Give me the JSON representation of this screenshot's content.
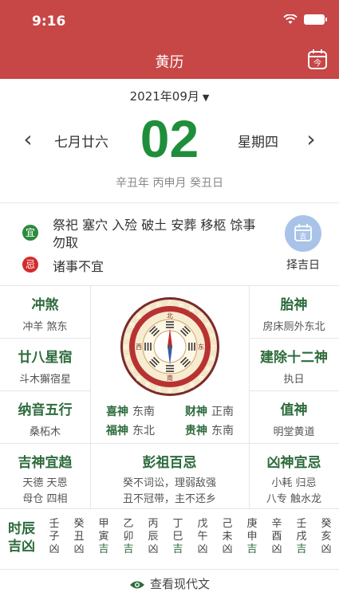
{
  "status": {
    "time": "9:16"
  },
  "nav": {
    "title": "黄历",
    "today_icon_text": "今"
  },
  "month": {
    "label": "2021年09月"
  },
  "day": {
    "lunar": "七月廿六",
    "number": "02",
    "weekday": "星期四",
    "ganzhi": "辛丑年 丙申月 癸丑日"
  },
  "yiji": {
    "yi_badge": "宜",
    "yi_text": "祭祀 塞穴 入殓 破土 安葬 移柩 馀事勿取",
    "ji_badge": "忌",
    "ji_text": "诸事不宜",
    "zeji_label": "择吉日",
    "zeji_icon": "吉"
  },
  "cells": {
    "chongsha": {
      "title": "冲煞",
      "sub": "冲羊 煞东"
    },
    "taishen": {
      "title": "胎神",
      "sub": "房床厕外东北"
    },
    "xiu": {
      "title": "廿八星宿",
      "sub": "斗木獬宿星"
    },
    "jianchu": {
      "title": "建除十二神",
      "sub": "执日"
    },
    "nayin": {
      "title": "纳音五行",
      "sub": "桑柘木"
    },
    "zhishen": {
      "title": "值神",
      "sub": "明堂黄道"
    },
    "jishen": {
      "title": "吉神宜趋",
      "sub1": "天德 天恩",
      "sub2": "母仓 四相"
    },
    "pengzu": {
      "title": "彭祖百忌",
      "sub1": "癸不词讼，理弱敌强",
      "sub2": "丑不冠带，主不还乡"
    },
    "xiongshen": {
      "title": "凶神宜忌",
      "sub1": "小耗 归忌",
      "sub2": "八专 触水龙"
    }
  },
  "gods": [
    {
      "k": "喜神",
      "v": "东南"
    },
    {
      "k": "财神",
      "v": "正南"
    },
    {
      "k": "福神",
      "v": "东北"
    },
    {
      "k": "贵神",
      "v": "东南"
    }
  ],
  "compass": {
    "outer": [
      "乙",
      "辰",
      "巽",
      "巳",
      "丙",
      "午",
      "丁",
      "未",
      "坤",
      "申",
      "庚",
      "酉",
      "辛",
      "戌",
      "乾",
      "亥",
      "壬",
      "子",
      "癸",
      "丑",
      "艮",
      "寅",
      "甲",
      "卯"
    ],
    "mid": [
      "南",
      "西",
      "北",
      "东"
    ]
  },
  "shichen": {
    "title": "时辰吉凶",
    "cols": [
      [
        "壬",
        "子",
        "凶"
      ],
      [
        "癸",
        "丑",
        "凶"
      ],
      [
        "甲",
        "寅",
        "吉"
      ],
      [
        "乙",
        "卯",
        "吉"
      ],
      [
        "丙",
        "辰",
        "凶"
      ],
      [
        "丁",
        "巳",
        "吉"
      ],
      [
        "戊",
        "午",
        "凶"
      ],
      [
        "己",
        "未",
        "凶"
      ],
      [
        "庚",
        "申",
        "吉"
      ],
      [
        "辛",
        "酉",
        "凶"
      ],
      [
        "壬",
        "戌",
        "吉"
      ],
      [
        "癸",
        "亥",
        "凶"
      ]
    ]
  },
  "modern": {
    "label": "查看现代文"
  },
  "colors": {
    "header": "#c74646",
    "green": "#1f8e3a",
    "red": "#d52b2b"
  }
}
